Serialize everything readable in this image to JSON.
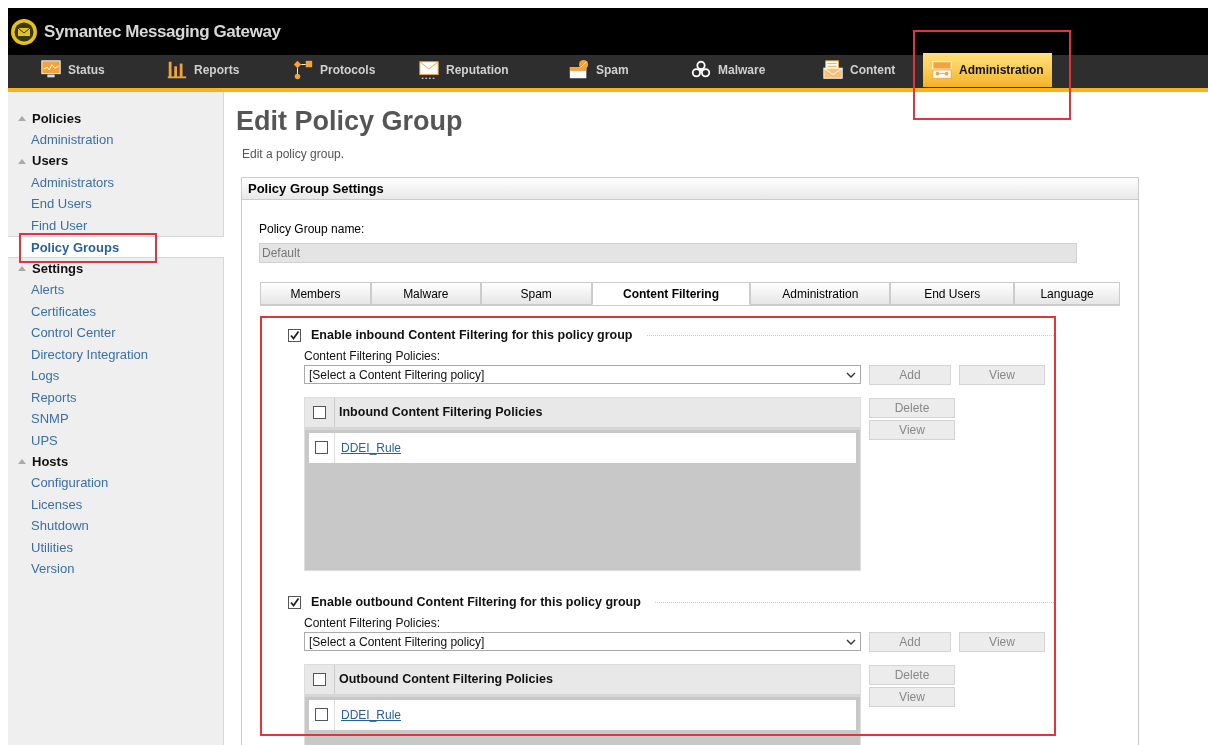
{
  "app": {
    "title": "Symantec Messaging Gateway"
  },
  "nav": [
    {
      "label": "Status",
      "kind": "monitor",
      "selected": false,
      "highlighted": false
    },
    {
      "label": "Reports",
      "kind": "bars",
      "selected": false,
      "highlighted": false
    },
    {
      "label": "Protocols",
      "kind": "flow",
      "selected": false,
      "highlighted": false
    },
    {
      "label": "Reputation",
      "kind": "envelope",
      "selected": false,
      "highlighted": false
    },
    {
      "label": "Spam",
      "kind": "spam",
      "selected": false,
      "highlighted": false
    },
    {
      "label": "Malware",
      "kind": "biohazard",
      "selected": false,
      "highlighted": false
    },
    {
      "label": "Content",
      "kind": "letter",
      "selected": false,
      "highlighted": false
    },
    {
      "label": "Administration",
      "kind": "toolbox",
      "selected": true,
      "highlighted": true
    }
  ],
  "sidebar": [
    {
      "title": "Policies",
      "expanded": true,
      "items": [
        {
          "label": "Administration",
          "selected": false,
          "highlighted": false
        }
      ]
    },
    {
      "title": "Users",
      "expanded": true,
      "items": [
        {
          "label": "Administrators",
          "selected": false,
          "highlighted": false
        },
        {
          "label": "End Users",
          "selected": false,
          "highlighted": false
        },
        {
          "label": "Find User",
          "selected": false,
          "highlighted": false
        },
        {
          "label": "Policy Groups",
          "selected": true,
          "highlighted": true
        }
      ]
    },
    {
      "title": "Settings",
      "expanded": true,
      "items": [
        {
          "label": "Alerts",
          "selected": false,
          "highlighted": false
        },
        {
          "label": "Certificates",
          "selected": false,
          "highlighted": false
        },
        {
          "label": "Control Center",
          "selected": false,
          "highlighted": false
        },
        {
          "label": "Directory Integration",
          "selected": false,
          "highlighted": false
        },
        {
          "label": "Logs",
          "selected": false,
          "highlighted": false
        },
        {
          "label": "Reports",
          "selected": false,
          "highlighted": false
        },
        {
          "label": "SNMP",
          "selected": false,
          "highlighted": false
        },
        {
          "label": "UPS",
          "selected": false,
          "highlighted": false
        }
      ]
    },
    {
      "title": "Hosts",
      "expanded": true,
      "items": [
        {
          "label": "Configuration",
          "selected": false,
          "highlighted": false
        },
        {
          "label": "Licenses",
          "selected": false,
          "highlighted": false
        },
        {
          "label": "Shutdown",
          "selected": false,
          "highlighted": false
        },
        {
          "label": "Utilities",
          "selected": false,
          "highlighted": false
        },
        {
          "label": "Version",
          "selected": false,
          "highlighted": false
        }
      ]
    }
  ],
  "page": {
    "title": "Edit Policy Group",
    "subtitle": "Edit a policy group."
  },
  "settings_panel": {
    "title": "Policy Group Settings",
    "name_label": "Policy Group name:",
    "name_value": "Default"
  },
  "tabs": [
    {
      "label": "Members",
      "selected": false
    },
    {
      "label": "Malware",
      "selected": false
    },
    {
      "label": "Spam",
      "selected": false
    },
    {
      "label": "Content Filtering",
      "selected": true
    },
    {
      "label": "Administration",
      "selected": false
    },
    {
      "label": "End Users",
      "selected": false
    },
    {
      "label": "Language",
      "selected": false
    }
  ],
  "content_filtering": {
    "highlighted": true,
    "sections": [
      {
        "label": "Enable inbound Content Filtering for this policy group",
        "checked": true,
        "policies_label": "Content Filtering Policies:",
        "select_value": "[Select a Content Filtering policy]",
        "add_button": "Add",
        "view_button": "View",
        "table_header": "Inbound Content Filtering Policies",
        "header_checked": false,
        "rows": [
          {
            "label": "DDEI_Rule",
            "checked": false
          }
        ],
        "delete_button": "Delete",
        "row_view_button": "View"
      },
      {
        "label": "Enable outbound Content Filtering for this policy group",
        "checked": true,
        "policies_label": "Content Filtering Policies:",
        "select_value": "[Select a Content Filtering policy]",
        "add_button": "Add",
        "view_button": "View",
        "table_header": "Outbound Content Filtering Policies",
        "header_checked": false,
        "rows": [
          {
            "label": "DDEI_Rule",
            "checked": false
          }
        ],
        "delete_button": "Delete",
        "row_view_button": "View"
      }
    ]
  }
}
